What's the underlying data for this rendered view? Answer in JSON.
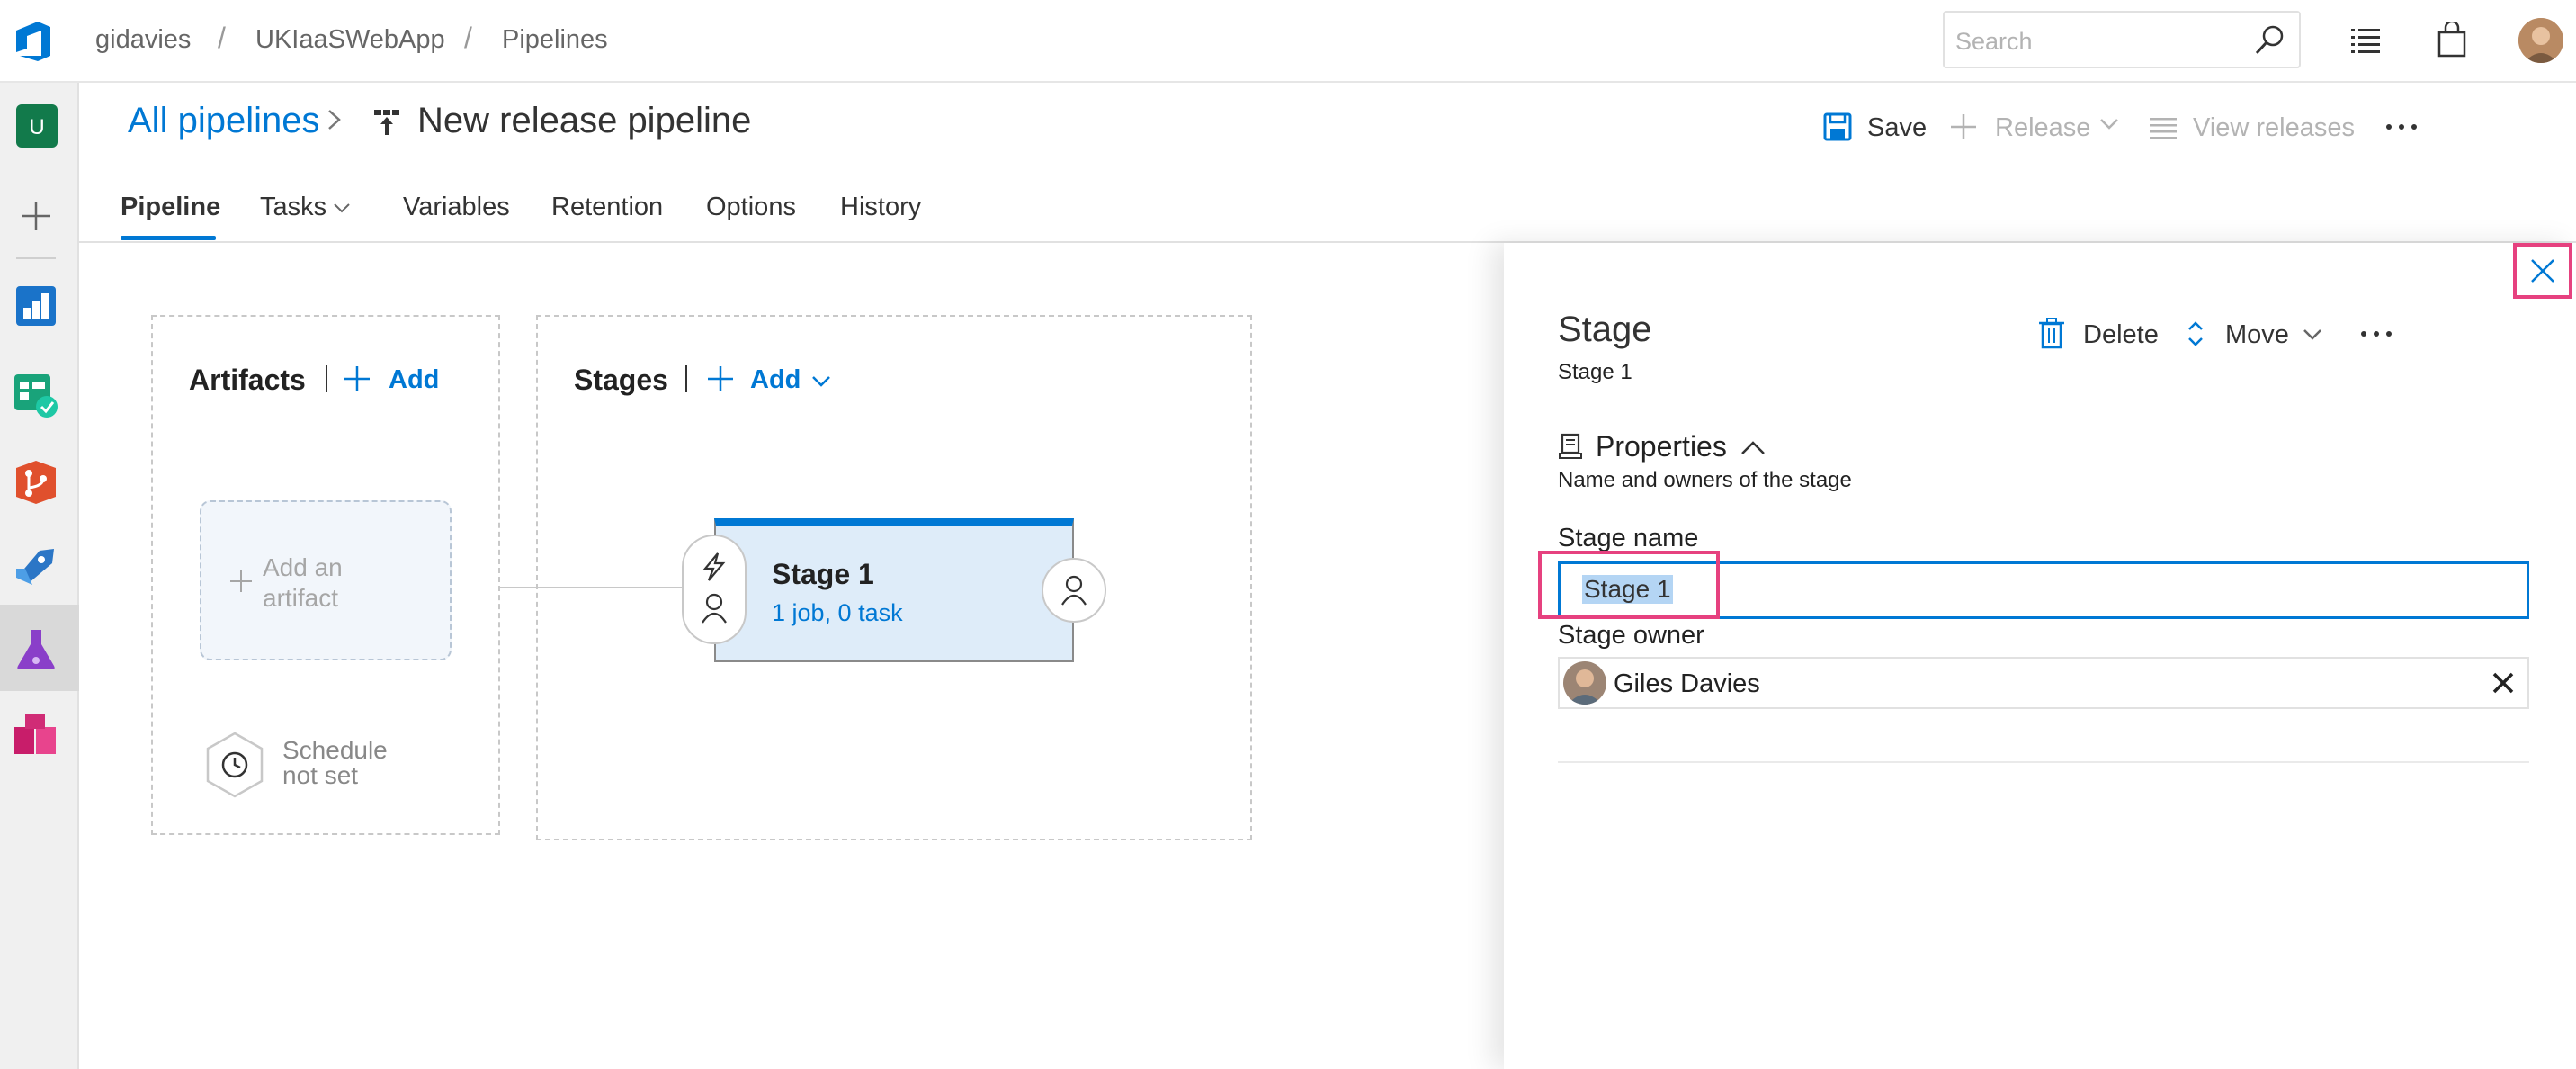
{
  "breadcrumbs": [
    "gidavies",
    "UKIaaSWebApp",
    "Pipelines"
  ],
  "search": {
    "placeholder": "Search"
  },
  "rail": {
    "project_initial": "U"
  },
  "header": {
    "all_pipelines": "All pipelines",
    "title": "New release pipeline",
    "save": "Save",
    "release": "Release",
    "view_releases": "View releases"
  },
  "tabs": [
    {
      "label": "Pipeline",
      "active": true
    },
    {
      "label": "Tasks"
    },
    {
      "label": "Variables"
    },
    {
      "label": "Retention"
    },
    {
      "label": "Options"
    },
    {
      "label": "History"
    }
  ],
  "canvas": {
    "artifacts_title": "Artifacts",
    "artifacts_add": "Add",
    "stages_title": "Stages",
    "stages_add": "Add",
    "add_artifact_line1": "Add an",
    "add_artifact_line2": "artifact",
    "schedule_line1": "Schedule",
    "schedule_line2": "not set",
    "stage": {
      "name": "Stage 1",
      "summary": "1 job, 0 task"
    }
  },
  "panel": {
    "title": "Stage",
    "subtitle": "Stage 1",
    "delete": "Delete",
    "move": "Move",
    "properties_title": "Properties",
    "properties_subtitle": "Name and owners of the stage",
    "stage_name_label": "Stage name",
    "stage_name_value": "Stage 1",
    "stage_owner_label": "Stage owner",
    "stage_owner_value": "Giles Davies"
  },
  "colors": {
    "accent": "#0078d4",
    "highlight": "#e6417f",
    "stage_bg": "#deecf9"
  }
}
